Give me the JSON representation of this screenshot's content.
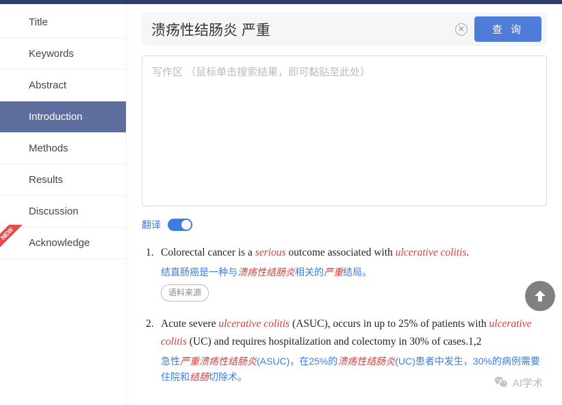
{
  "sidebar": {
    "items": [
      {
        "label": "Title"
      },
      {
        "label": "Keywords"
      },
      {
        "label": "Abstract"
      },
      {
        "label": "Introduction",
        "active": true
      },
      {
        "label": "Methods"
      },
      {
        "label": "Results"
      },
      {
        "label": "Discussion"
      },
      {
        "label": "Acknowledge",
        "new": true
      }
    ]
  },
  "search": {
    "value": "溃疡性结肠炎 严重",
    "query_label": "查 询"
  },
  "writearea": {
    "placeholder": "写作区 （鼠标单击搜索结果，即可黏贴至此处）"
  },
  "translate": {
    "label": "翻译",
    "on": true
  },
  "results": [
    {
      "num": "1.",
      "en_parts": [
        {
          "t": "Colorectal cancer is a "
        },
        {
          "t": "serious",
          "hl": true
        },
        {
          "t": " outcome associated with "
        },
        {
          "t": "ulcerative colitis",
          "hl": true
        },
        {
          "t": "."
        }
      ],
      "zh_parts": [
        {
          "t": "结直肠癌是一种与"
        },
        {
          "t": "溃疡性结肠炎",
          "hl": true
        },
        {
          "t": "相关的"
        },
        {
          "t": "严重",
          "hl": true
        },
        {
          "t": "结局。"
        }
      ],
      "source_label": "语料来源"
    },
    {
      "num": "2.",
      "en_parts": [
        {
          "t": "Acute severe "
        },
        {
          "t": "ulcerative colitis",
          "hl": true
        },
        {
          "t": " (ASUC), occurs in up to 25% of patients with "
        },
        {
          "t": "ulcerative colitis",
          "hl": true
        },
        {
          "t": " (UC) and requires hospitalization and colectomy in 30% of cases.1,2"
        }
      ],
      "zh_parts": [
        {
          "t": "急性"
        },
        {
          "t": "严重溃疡性结肠炎",
          "hl": true
        },
        {
          "t": "(ASUC)，在25%的"
        },
        {
          "t": "溃疡性结肠炎",
          "hl": true
        },
        {
          "t": "(UC)患者中发生，30%的病例需要住院和"
        },
        {
          "t": "结肠",
          "hl": true
        },
        {
          "t": "切除术。"
        }
      ]
    }
  ],
  "watermark": "AI学术"
}
